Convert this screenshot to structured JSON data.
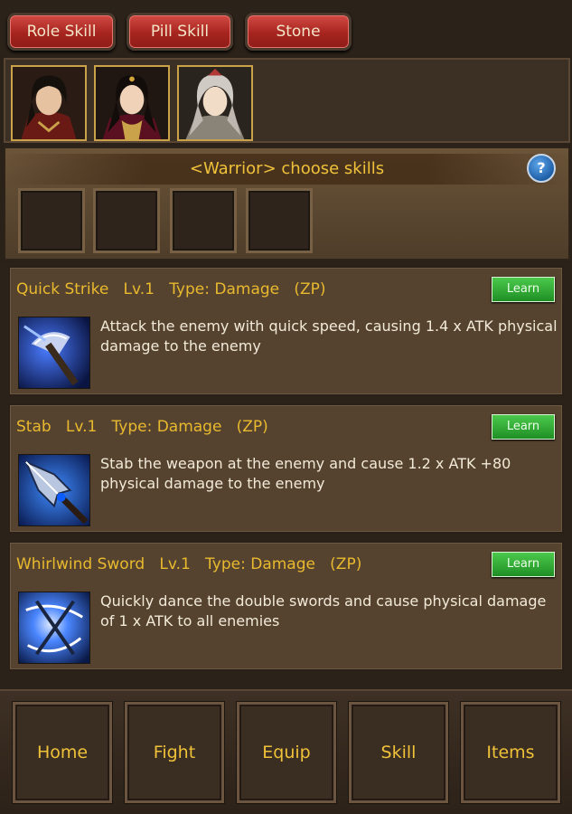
{
  "tabs": [
    {
      "label": "Role Skill"
    },
    {
      "label": "Pill Skill"
    },
    {
      "label": "Stone"
    }
  ],
  "portraits": [
    {
      "name": "warrior-portrait"
    },
    {
      "name": "mage-portrait"
    },
    {
      "name": "priest-portrait"
    }
  ],
  "choose_panel": {
    "title": "<Warrior> choose skills",
    "help_label": "?"
  },
  "skills": [
    {
      "header": "Quick Strike   Lv.1   Type: Damage   (ZP)",
      "learn_label": "Learn",
      "description": "Attack the enemy with quick speed, causing 1.4 x ATK physical damage to the enemy",
      "icon": "axe-icon"
    },
    {
      "header": "Stab   Lv.1   Type: Damage   (ZP)",
      "learn_label": "Learn",
      "description": "Stab the weapon at the enemy and cause 1.2 x ATK +80 physical damage to the enemy",
      "icon": "spear-icon"
    },
    {
      "header": "Whirlwind Sword   Lv.1   Type: Damage   (ZP)",
      "learn_label": "Learn",
      "description": "Quickly dance the double swords and cause physical damage of 1 x ATK to all enemies",
      "icon": "whirlwind-icon"
    }
  ],
  "nav": [
    {
      "label": "Home"
    },
    {
      "label": "Fight"
    },
    {
      "label": "Equip"
    },
    {
      "label": "Skill"
    },
    {
      "label": "Items"
    }
  ],
  "colors": {
    "tab_red": "#b52a24",
    "title_gold": "#f0c23a",
    "learn_green": "#2fa635",
    "panel_brown": "#55432f"
  }
}
